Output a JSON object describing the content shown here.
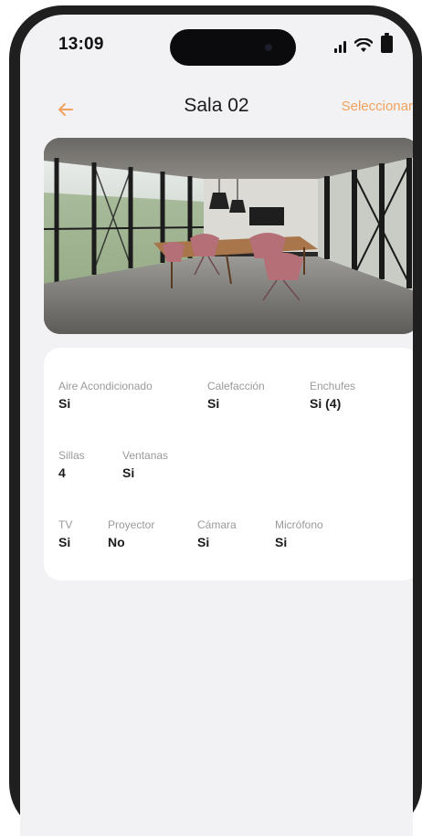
{
  "status_bar": {
    "time": "13:09",
    "icons": [
      "signal-icon",
      "wifi-icon",
      "battery-icon"
    ]
  },
  "nav": {
    "back_icon": "arrow-left-icon",
    "title": "Sala 02",
    "action_label": "Seleccionar"
  },
  "colors": {
    "accent": "#F2A25D",
    "background": "#F2F2F5",
    "card": "#FFFFFF",
    "label": "#9A9A9A",
    "value": "#1C1C1C"
  },
  "room_photo": {
    "alt": "meeting-room-photo"
  },
  "features": {
    "row1": [
      {
        "label": "Aire Acondicionado",
        "value": "Si"
      },
      {
        "label": "Calefacción",
        "value": "Si"
      },
      {
        "label": "Enchufes",
        "value": "Si (4)"
      }
    ],
    "row2": [
      {
        "label": "Sillas",
        "value": "4"
      },
      {
        "label": "Ventanas",
        "value": "Si"
      }
    ],
    "row3": [
      {
        "label": "TV",
        "value": "Si"
      },
      {
        "label": "Proyector",
        "value": "No"
      },
      {
        "label": "Cámara",
        "value": "Si"
      },
      {
        "label": "Micrófono",
        "value": "Si"
      }
    ]
  }
}
